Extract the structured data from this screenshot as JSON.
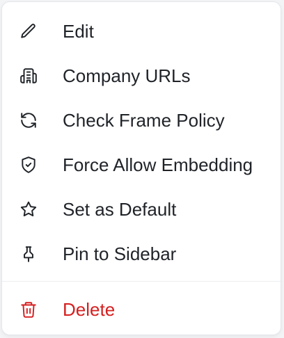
{
  "menu": {
    "items": [
      {
        "label": "Edit",
        "icon": "pencil-icon"
      },
      {
        "label": "Company URLs",
        "icon": "building-icon"
      },
      {
        "label": "Check Frame Policy",
        "icon": "refresh-icon"
      },
      {
        "label": "Force Allow Embedding",
        "icon": "shield-check-icon"
      },
      {
        "label": "Set as Default",
        "icon": "star-icon"
      },
      {
        "label": "Pin to Sidebar",
        "icon": "pin-icon"
      }
    ],
    "danger_item": {
      "label": "Delete",
      "icon": "trash-icon"
    }
  },
  "colors": {
    "text": "#1f2328",
    "danger": "#d61f1f",
    "border": "#e5e7eb",
    "background": "#ffffff"
  }
}
